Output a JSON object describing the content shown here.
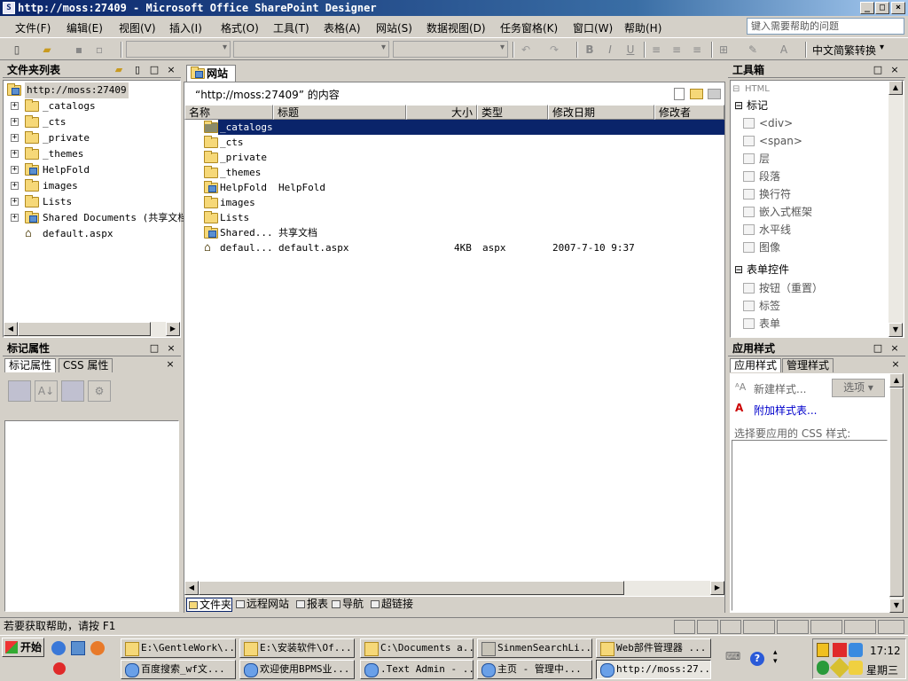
{
  "window": {
    "title": "http://moss:27409 - Microsoft Office SharePoint Designer",
    "min_label": "_",
    "max_label": "□",
    "close_label": "×"
  },
  "menu": {
    "items": [
      "文件(F)",
      "编辑(E)",
      "视图(V)",
      "插入(I)",
      "格式(O)",
      "工具(T)",
      "表格(A)",
      "网站(S)",
      "数据视图(D)",
      "任务窗格(K)",
      "窗口(W)",
      "帮助(H)"
    ],
    "help_placeholder": "键入需要帮助的问题"
  },
  "toolbar": {
    "lang_convert": "中文简繁转换",
    "bold": "B",
    "italic": "I",
    "underline": "U"
  },
  "folder_list": {
    "title": "文件夹列表",
    "root": "http://moss:27409",
    "items": [
      {
        "name": "_catalogs",
        "type": "folder",
        "expandable": true
      },
      {
        "name": "_cts",
        "type": "folder",
        "expandable": true
      },
      {
        "name": "_private",
        "type": "folder",
        "expandable": true
      },
      {
        "name": "_themes",
        "type": "folder",
        "expandable": true
      },
      {
        "name": "HelpFold",
        "type": "web",
        "expandable": true
      },
      {
        "name": "images",
        "type": "folder",
        "expandable": true
      },
      {
        "name": "Lists",
        "type": "folder",
        "expandable": true
      },
      {
        "name": "Shared Documents (共享文档)",
        "type": "web",
        "expandable": true
      },
      {
        "name": "default.aspx",
        "type": "home",
        "expandable": false
      }
    ]
  },
  "tag_props": {
    "title": "标记属性",
    "tabs": [
      "标记属性",
      "CSS 属性"
    ]
  },
  "site": {
    "tab": "网站",
    "path_label": "“http://moss:27409” 的内容",
    "columns": [
      "名称",
      "标题",
      "大小",
      "类型",
      "修改日期",
      "修改者"
    ],
    "rows": [
      {
        "name": "_catalogs",
        "title": "",
        "size": "",
        "type": "",
        "date": "",
        "icon": "folder-dark",
        "selected": true
      },
      {
        "name": "_cts",
        "title": "",
        "size": "",
        "type": "",
        "date": "",
        "icon": "folder"
      },
      {
        "name": "_private",
        "title": "",
        "size": "",
        "type": "",
        "date": "",
        "icon": "folder"
      },
      {
        "name": "_themes",
        "title": "",
        "size": "",
        "type": "",
        "date": "",
        "icon": "folder"
      },
      {
        "name": "HelpFold",
        "title": "HelpFold",
        "size": "",
        "type": "",
        "date": "",
        "icon": "web"
      },
      {
        "name": "images",
        "title": "",
        "size": "",
        "type": "",
        "date": "",
        "icon": "folder"
      },
      {
        "name": "Lists",
        "title": "",
        "size": "",
        "type": "",
        "date": "",
        "icon": "folder"
      },
      {
        "name": "Shared...",
        "title": "共享文档",
        "size": "",
        "type": "",
        "date": "",
        "icon": "web"
      },
      {
        "name": "defaul...",
        "title": "default.aspx",
        "size": "4KB",
        "type": "aspx",
        "date": "2007-7-10 9:37",
        "icon": "home"
      }
    ],
    "bottom_tabs": [
      "文件夹",
      "远程网站",
      "报表",
      "导航",
      "超链接"
    ]
  },
  "toolbox": {
    "title": "工具箱",
    "html_label": "HTML",
    "group_tags": "标记",
    "tags": [
      "<div>",
      "<span>",
      "层",
      "段落",
      "换行符",
      "嵌入式框架",
      "水平线",
      "图像"
    ],
    "group_forms": "表单控件",
    "forms": [
      "按钮（重置）",
      "标签",
      "表单"
    ]
  },
  "apply_styles": {
    "title": "应用样式",
    "tabs": [
      "应用样式",
      "管理样式"
    ],
    "new_style": "新建样式...",
    "options": "选项",
    "attach": "附加样式表...",
    "select_label": "选择要应用的 CSS 样式:"
  },
  "status": {
    "text": "若要获取帮助，请按 F1"
  },
  "taskbar": {
    "start": "开始",
    "row1": [
      "E:\\GentleWork\\...",
      "E:\\安装软件\\Of...",
      "C:\\Documents a...",
      "SinmenSearchLi...",
      "Web部件管理器 ..."
    ],
    "row2": [
      "百度搜索_wf文...",
      "欢迎使用BPMS业...",
      ".Text Admin - ...",
      "主页 - 管理中...",
      "http://moss:27..."
    ],
    "time": "17:12",
    "day": "星期三"
  },
  "colors": {
    "title_start": "#0a246a",
    "title_end": "#a6caf0",
    "selection": "#0a246a",
    "link": "#0000cc"
  }
}
